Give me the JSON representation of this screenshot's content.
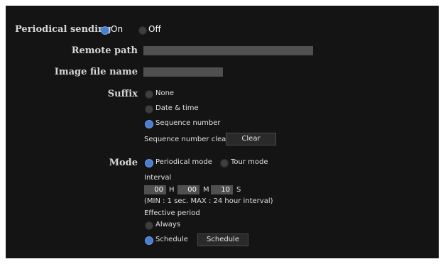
{
  "periodical_sending": {
    "label": "Periodical sending",
    "on_label": "On",
    "off_label": "Off",
    "selected": "On"
  },
  "remote_path": {
    "label": "Remote path",
    "value": ""
  },
  "image_file_name": {
    "label": "Image file name",
    "value": ""
  },
  "suffix": {
    "label": "Suffix",
    "options": [
      "None",
      "Date & time",
      "Sequence number"
    ],
    "selected": "Sequence number",
    "seq_clear_label": "Sequence number clear",
    "clear_button": "Clear"
  },
  "mode": {
    "label": "Mode",
    "periodical_label": "Periodical mode",
    "tour_label": "Tour mode",
    "selected": "Periodical mode",
    "interval_label": "Interval",
    "hours": "00",
    "h_unit": "H",
    "minutes": "00",
    "m_unit": "M",
    "seconds": "10",
    "s_unit": "S",
    "interval_note": "(MIN : 1 sec. MAX : 24 hour interval)",
    "effective_period_label": "Effective period",
    "always_label": "Always",
    "schedule_label": "Schedule",
    "schedule_selected": "Schedule",
    "schedule_button": "Schedule"
  },
  "colors": {
    "background": "#141414",
    "field": "#505050",
    "radio_on": "#4a7fd0",
    "radio_off": "#3e3e3e"
  }
}
